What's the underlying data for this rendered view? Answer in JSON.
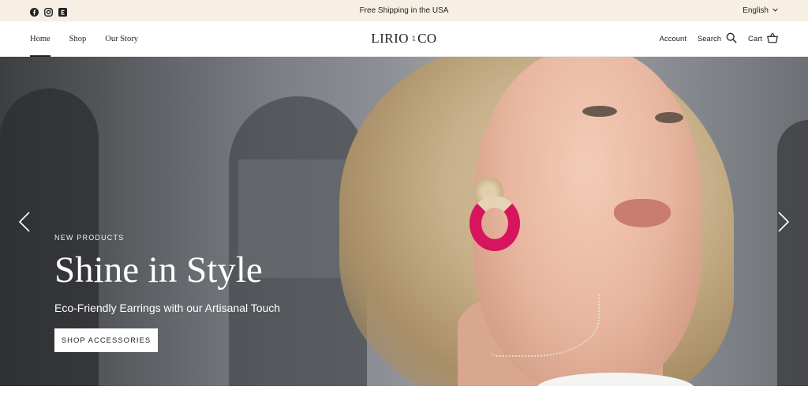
{
  "announcement": {
    "text": "Free Shipping in the USA",
    "language": "English",
    "social_icons": [
      "facebook-icon",
      "instagram-icon",
      "etsy-icon"
    ]
  },
  "header": {
    "nav": [
      "Home",
      "Shop",
      "Our Story"
    ],
    "logo_main": "LIRIO",
    "logo_and": "and",
    "logo_co": "CO",
    "account_label": "Account",
    "search_label": "Search",
    "cart_label": "Cart"
  },
  "hero": {
    "eyebrow": "NEW PRODUCTS",
    "headline": "Shine in Style",
    "subline": "Eco-Friendly Earrings with our Artisanal Touch",
    "cta_label": "SHOP ACCESSORIES"
  },
  "colors": {
    "announcement_bg": "#f7efe3",
    "earring_accent": "#d7145e",
    "text": "#222222"
  }
}
